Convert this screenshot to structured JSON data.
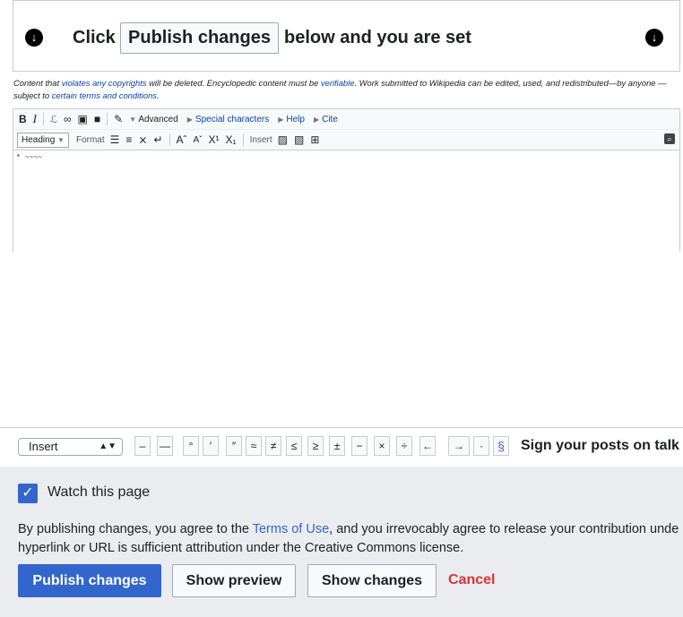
{
  "notice": {
    "click": "Click",
    "button_label": "Publish changes",
    "suffix": "below and you are set",
    "arrow_icon": "arrow-circle-down-icon"
  },
  "license": {
    "p1": "Content that ",
    "link1": "violates any copyrights",
    "p2": " will be deleted. Encyclopedic content must be ",
    "link2": "verifiable",
    "p3": ". Work submitted to Wikipedia can be edited, used, and redistributed—by anyone —subject to ",
    "link3": "certain terms and conditions",
    "p4": "."
  },
  "toolbar": {
    "bold": "B",
    "italic": "I",
    "advanced": "Advanced",
    "special_characters": "Special characters",
    "help": "Help",
    "cite": "Cite",
    "heading": "Heading",
    "format": "Format",
    "insert": "Insert"
  },
  "editor": {
    "content": "* ~~~~"
  },
  "insert_bar": {
    "select_value": "Insert",
    "chars": [
      "–",
      "—",
      "°",
      "′",
      "″",
      "≈",
      "≠",
      "≤",
      "≥",
      "±",
      "−",
      "×",
      "÷",
      "←",
      "→",
      "·",
      "§"
    ],
    "sign_label": "Sign your posts on talk"
  },
  "options": {
    "watch_label": "Watch this page",
    "agree_p1": "By publishing changes, you agree to the ",
    "terms_link": "Terms of Use",
    "agree_p2": ", and you irrevocably agree to release your contribution unde",
    "agree_line2": "hyperlink or URL is sufficient attribution under the Creative Commons license.",
    "publish": "Publish changes",
    "preview": "Show preview",
    "changes": "Show changes",
    "cancel": "Cancel"
  },
  "colors": {
    "progressive": "#3366cc",
    "destructive": "#dd3333",
    "link": "#0645ad"
  }
}
